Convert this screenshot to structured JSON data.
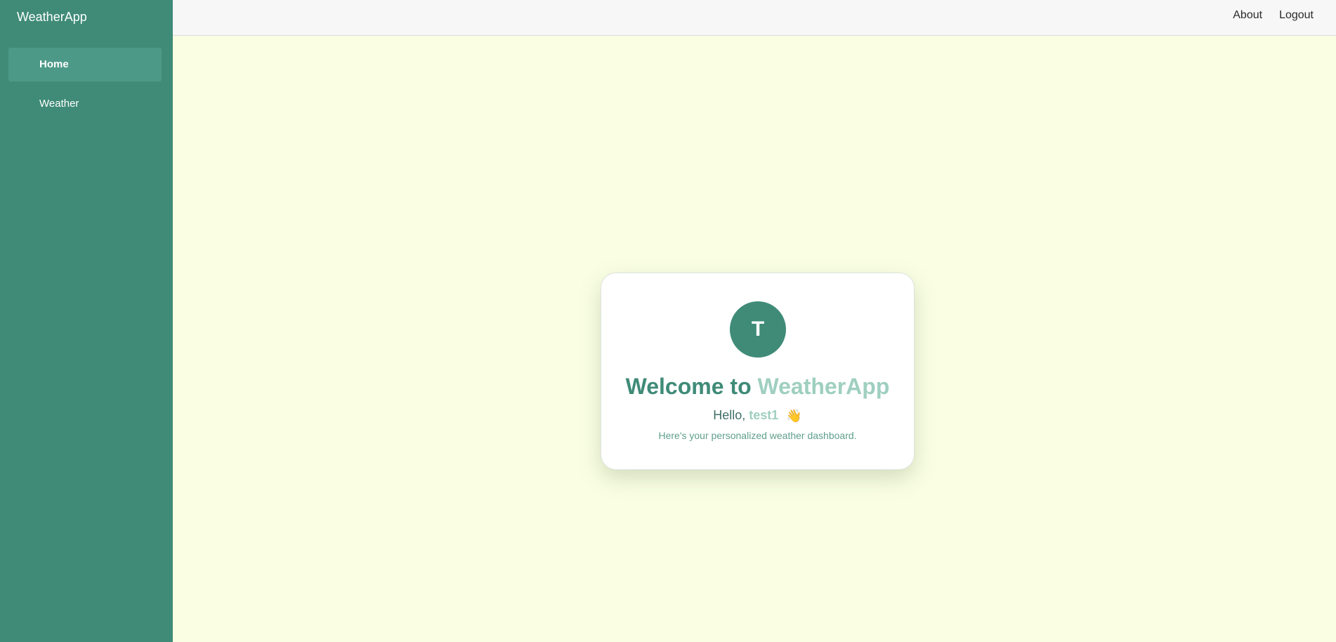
{
  "app": {
    "brand": "WeatherApp"
  },
  "sidebar": {
    "items": [
      {
        "label": "Home",
        "active": true
      },
      {
        "label": "Weather",
        "active": false
      }
    ]
  },
  "topbar": {
    "links": [
      "About",
      "Logout"
    ]
  },
  "card": {
    "avatar_initial": "T",
    "welcome_prefix": "Welcome to",
    "welcome_app": "WeatherApp",
    "hello_prefix": "Hello,",
    "username": "test1",
    "wave_emoji": "👋",
    "subtitle": "Here's your personalized weather dashboard."
  },
  "colors": {
    "primary": "#3F8B78",
    "accent": "#9FCFC0",
    "background": "#FAFFE4"
  }
}
